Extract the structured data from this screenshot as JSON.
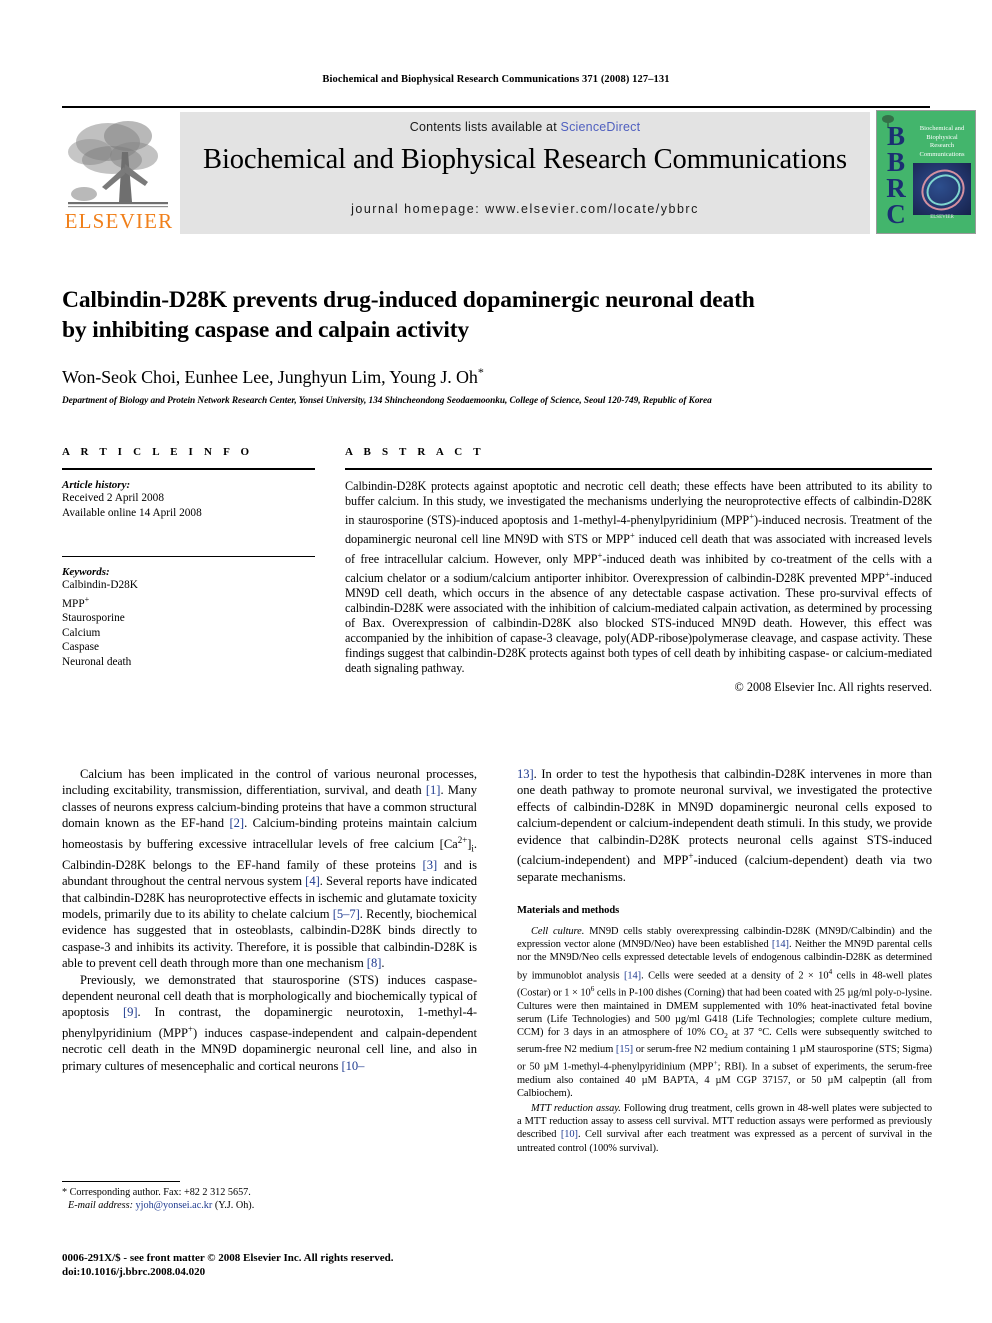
{
  "running_head": "Biochemical and Biophysical Research Communications 371 (2008) 127–131",
  "masthead": {
    "contents_prefix": "Contents lists available at ",
    "sciencedirect": "ScienceDirect",
    "journal_title": "Biochemical and Biophysical Research Communications",
    "homepage": "journal homepage: www.elsevier.com/locate/ybbrc",
    "publisher_wordmark": "ELSEVIER",
    "cover": {
      "letters": "BBRC",
      "name_line1": "Biochemical and",
      "name_line2": "Biophysical",
      "name_line3": "Research",
      "name_line4": "Communications",
      "publisher": "ELSEVIER"
    }
  },
  "colors": {
    "elsevier_orange": "#f07f1a",
    "sciencedirect_blue": "#4f5fbf",
    "reference_blue": "#1e3a8f",
    "band_gray": "#e3e3e3",
    "cover_green": "#43b56c",
    "cover_letter_blue": "#1b2f72"
  },
  "article": {
    "title_line1": "Calbindin-D28K prevents drug-induced dopaminergic neuronal death",
    "title_line2": "by inhibiting caspase and calpain activity",
    "authors": "Won-Seok Choi, Eunhee Lee, Junghyun Lim, Young J. Oh",
    "corresponding_marker": "*",
    "affiliation": "Department of Biology and Protein Network Research Center, Yonsei University, 134 Shincheondong Seodaemoonku, College of Science, Seoul 120-749, Republic of Korea"
  },
  "article_info": {
    "heading": "A R T I C L E   I N F O",
    "history_label": "Article history:",
    "received": "Received 2 April 2008",
    "available": "Available online 14 April 2008",
    "keywords_label": "Keywords:",
    "keywords": [
      "Calbindin-D28K",
      "MPP+",
      "Staurosporine",
      "Calcium",
      "Caspase",
      "Neuronal death"
    ]
  },
  "abstract": {
    "heading": "A B S T R A C T",
    "text": "Calbindin-D28K protects against apoptotic and necrotic cell death; these effects have been attributed to its ability to buffer calcium. In this study, we investigated the mechanisms underlying the neuroprotective effects of calbindin-D28K in staurosporine (STS)-induced apoptosis and 1-methyl-4-phenylpyridinium (MPP+)-induced necrosis. Treatment of the dopaminergic neuronal cell line MN9D with STS or MPP+ induced cell death that was associated with increased levels of free intracellular calcium. However, only MPP+-induced death was inhibited by co-treatment of the cells with a calcium chelator or a sodium/calcium antiporter inhibitor. Overexpression of calbindin-D28K prevented MPP+-induced MN9D cell death, which occurs in the absence of any detectable caspase activation. These pro-survival effects of calbindin-D28K were associated with the inhibition of calcium-mediated calpain activation, as determined by processing of Bax. Overexpression of calbindin-D28K also blocked STS-induced MN9D death. However, this effect was accompanied by the inhibition of capase-3 cleavage, poly(ADP-ribose)polymerase cleavage, and caspase activity. These findings suggest that calbindin-D28K protects against both types of cell death by inhibiting caspase- or calcium-mediated death signaling pathway.",
    "copyright": "© 2008 Elsevier Inc. All rights reserved."
  },
  "body": {
    "left_para1": "Calcium has been implicated in the control of various neuronal processes, including excitability, transmission, differentiation, survival, and death [1]. Many classes of neurons express calcium-binding proteins that have a common structural domain known as the EF-hand [2]. Calcium-binding proteins maintain calcium homeostasis by buffering excessive intracellular levels of free calcium [Ca2+]i. Calbindin-D28K belongs to the EF-hand family of these proteins [3] and is abundant throughout the central nervous system [4]. Several reports have indicated that calbindin-D28K has neuroprotective effects in ischemic and glutamate toxicity models, primarily due to its ability to chelate calcium [5–7]. Recently, biochemical evidence has suggested that in osteoblasts, calbindin-D28K binds directly to caspase-3 and inhibits its activity. Therefore, it is possible that calbindin-D28K is able to prevent cell death through more than one mechanism [8].",
    "left_para2": "Previously, we demonstrated that staurosporine (STS) induces caspase-dependent neuronal cell death that is morphologically and biochemically typical of apoptosis [9]. In contrast, the dopaminergic neurotoxin, 1-methyl-4-phenylpyridinium (MPP+) induces caspase-independent and calpain-dependent necrotic cell death in the MN9D dopaminergic neuronal cell line, and also in primary cultures of mesencephalic and cortical neurons [10–13]. In order to test the hypothesis that calbindin-D28K intervenes in more than one death pathway to promote neuronal survival, we investigated the protective effects of calbindin-D28K in MN9D dopaminergic neuronal cells exposed to calcium-dependent or calcium-independent death stimuli. In this study, we provide evidence that calbindin-D28K protects neuronal cells against STS-induced (calcium-independent) and MPP+-induced (calcium-dependent) death via two separate mechanisms."
  },
  "materials_methods": {
    "heading": "Materials and methods",
    "sections": [
      {
        "lead": "Cell culture.",
        "text": "MN9D cells stably overexpressing calbindin-D28K (MN9D/Calbindin) and the expression vector alone (MN9D/Neo) have been established [14]. Neither the MN9D parental cells nor the MN9D/Neo cells expressed detectable levels of endogenous calbindin-D28K as determined by immunoblot analysis [14]. Cells were seeded at a density of 2 × 104 cells in 48-well plates (Costar) or 1 × 106 cells in P-100 dishes (Corning) that had been coated with 25 µg/ml poly-D-lysine. Cultures were then maintained in DMEM supplemented with 10% heat-inactivated fetal bovine serum (Life Technologies) and 500 µg/ml G418 (Life Technologies; complete culture medium, CCM) for 3 days in an atmosphere of 10% CO2 at 37 °C. Cells were subsequently switched to serum-free N2 medium [15] or serum-free N2 medium containing 1 µM staurosporine (STS; Sigma) or 50 µM 1-methyl-4-phenylpyridinium (MPP+; RBI). In a subset of experiments, the serum-free medium also contained 40 µM BAPTA, 4 µM CGP 37157, or 50 µM calpeptin (all from Calbiochem)."
      },
      {
        "lead": "MTT reduction assay.",
        "text": "Following drug treatment, cells grown in 48-well plates were subjected to a MTT reduction assay to assess cell survival. MTT reduction assays were performed as previously described [10]. Cell survival after each treatment was expressed as a percent of survival in the untreated control (100% survival)."
      }
    ]
  },
  "footnote": {
    "corresponding": "Corresponding author. Fax: +82 2 312 5657.",
    "email_label": "E-mail address:",
    "email": "yjoh@yonsei.ac.kr",
    "email_suffix": "(Y.J. Oh)."
  },
  "issn_block": {
    "line1": "0006-291X/$ - see front matter © 2008 Elsevier Inc. All rights reserved.",
    "line2": "doi:10.1016/j.bbrc.2008.04.020"
  }
}
